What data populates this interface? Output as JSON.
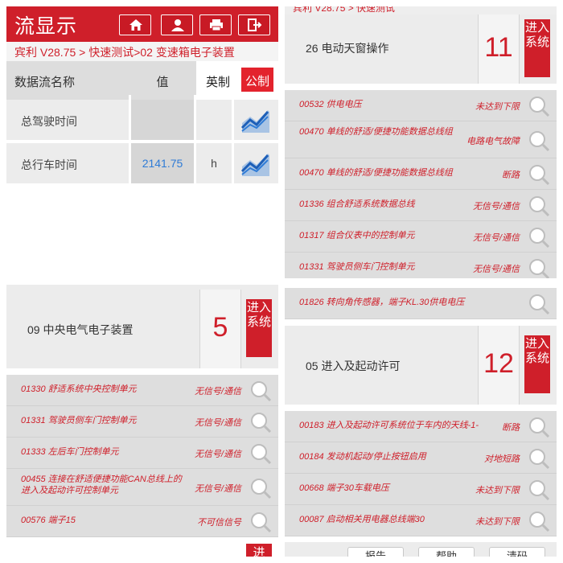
{
  "tl": {
    "title": "流显示",
    "icons": [
      "home-icon",
      "user-icon",
      "printer-icon",
      "exit-icon"
    ],
    "breadcrumb": "宾利 V28.75 > 快速测试>02 变速箱电子装置",
    "header": {
      "name": "数据流名称",
      "value": "值",
      "unit_en": "英制",
      "unit_metric": "公制"
    },
    "rows": [
      {
        "name": "总驾驶时间",
        "value": "",
        "unit": ""
      },
      {
        "name": "总行车时间",
        "value": "2141.75",
        "unit": "h"
      }
    ]
  },
  "tr": {
    "top_strip": "宾利 V28.75 > 快速测试",
    "module": {
      "name": "26 电动天窗操作",
      "count": "11",
      "enter": "进入系统"
    },
    "faults": [
      {
        "code": "00532 供电电压",
        "status": "未达到下限"
      },
      {
        "code": "00470 单线的舒适/便捷功能数据总线组",
        "status": "电路电气故障",
        "tall": true
      },
      {
        "code": "00470 单线的舒适/便捷功能数据总线组",
        "status": "断路"
      },
      {
        "code": "01336 组合舒适系统数据总线",
        "status": "无信号/通信"
      },
      {
        "code": "01317 组合仪表中的控制单元",
        "status": "无信号/通信"
      },
      {
        "code": "01331 驾驶员侧车门控制单元",
        "status": "无信号/通信"
      }
    ]
  },
  "bl": {
    "module": {
      "name": "09 中央电气电子装置",
      "count": "5",
      "enter": "进入系统"
    },
    "faults": [
      {
        "code": "01330 舒适系统中央控制单元",
        "status": "无信号/通信"
      },
      {
        "code": "01331 驾驶员侧车门控制单元",
        "status": "无信号/通信"
      },
      {
        "code": "01333 左后车门控制单元",
        "status": "无信号/通信"
      },
      {
        "code": "00455 连接在舒适便捷功能CAN总线上的进入及起动许可控制单元",
        "status": "无信号/通信",
        "tall": true
      },
      {
        "code": "00576 端子15",
        "status": "不可信信号"
      }
    ],
    "next_enter": "进"
  },
  "br": {
    "top_fault": {
      "code": "01826 转向角传感器，端子KL.30供电电压",
      "status": ""
    },
    "module": {
      "name": "05 进入及起动许可",
      "count": "12",
      "enter": "进入系统"
    },
    "faults": [
      {
        "code": "00183 进入及起动许可系统位于车内的天线-1-",
        "status": "断路"
      },
      {
        "code": "00184 发动机起动/停止按钮启用",
        "status": "对地短路"
      },
      {
        "code": "00668 端子30车载电压",
        "status": "未达到下限"
      },
      {
        "code": "00087 启动相关用电器总线端30",
        "status": "未达到下限"
      }
    ],
    "buttons": [
      "报告",
      "帮助",
      "清码"
    ]
  },
  "colors": {
    "accent": "#cf1f2a",
    "value_blue": "#2e7bd6",
    "row_bg": "#ececec"
  }
}
